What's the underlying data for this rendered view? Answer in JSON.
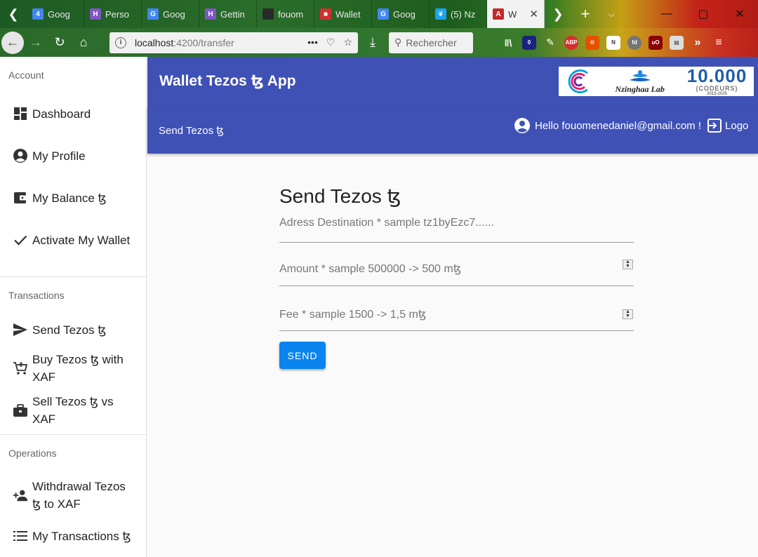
{
  "browser": {
    "tabs": [
      {
        "label": "Goog",
        "favicon": "4",
        "color": "#4285f4"
      },
      {
        "label": "Perso",
        "favicon": "H",
        "color": "#7e57c2"
      },
      {
        "label": "Goog",
        "favicon": "G",
        "color": "#4285f4"
      },
      {
        "label": "Gettin",
        "favicon": "H",
        "color": "#7e57c2"
      },
      {
        "label": "fouom",
        "favicon": "",
        "color": "#2a2a2a"
      },
      {
        "label": "Wallet",
        "favicon": "■",
        "color": "#d32f2f"
      },
      {
        "label": "Goog",
        "favicon": "G",
        "color": "#4285f4"
      },
      {
        "label": "(5) Nz",
        "favicon": "❦",
        "color": "#1da1f2"
      },
      {
        "label": "W",
        "favicon": "A",
        "color": "#c62828"
      }
    ],
    "url_host": "localhost",
    "url_path": ":4200/transfer",
    "search_placeholder": "Rechercher"
  },
  "sidebar": {
    "sections": [
      {
        "title": "Account",
        "items": [
          "Dashboard",
          "My Profile",
          "My Balance ꜩ",
          "Activate My Wallet"
        ]
      },
      {
        "title": "Transactions",
        "items": [
          "Send Tezos ꜩ",
          "Buy Tezos ꜩ with XAF",
          "Sell Tezos ꜩ vs XAF"
        ]
      },
      {
        "title": "Operations",
        "items": [
          "Withdrawal Tezos ꜩ to XAF",
          "My Transactions ꜩ"
        ]
      }
    ]
  },
  "header": {
    "app_title": "Wallet Tezos ꜩ App",
    "nav_link": "Send Tezos ꜩ",
    "greeting": "Hello fouomenedaniel@gmail.com !",
    "logout": "Logo",
    "logo_lab": "Nzinghaa Lab",
    "logo_10k": "10.000",
    "logo_10k_sub": "{CODEURS}",
    "logo_10k_years": "2015-2025"
  },
  "form": {
    "title": "Send Tezos ꜩ",
    "address_placeholder": "Adress Destination * sample tz1byEzc7......",
    "amount_placeholder": "Amount * sample 500000 -> 500 mꜩ",
    "fee_placeholder": "Fee * sample 1500 -> 1,5 mꜩ",
    "send_label": "SEND"
  },
  "colors": {
    "primary": "#3f51b5",
    "button": "#0a84ee"
  }
}
